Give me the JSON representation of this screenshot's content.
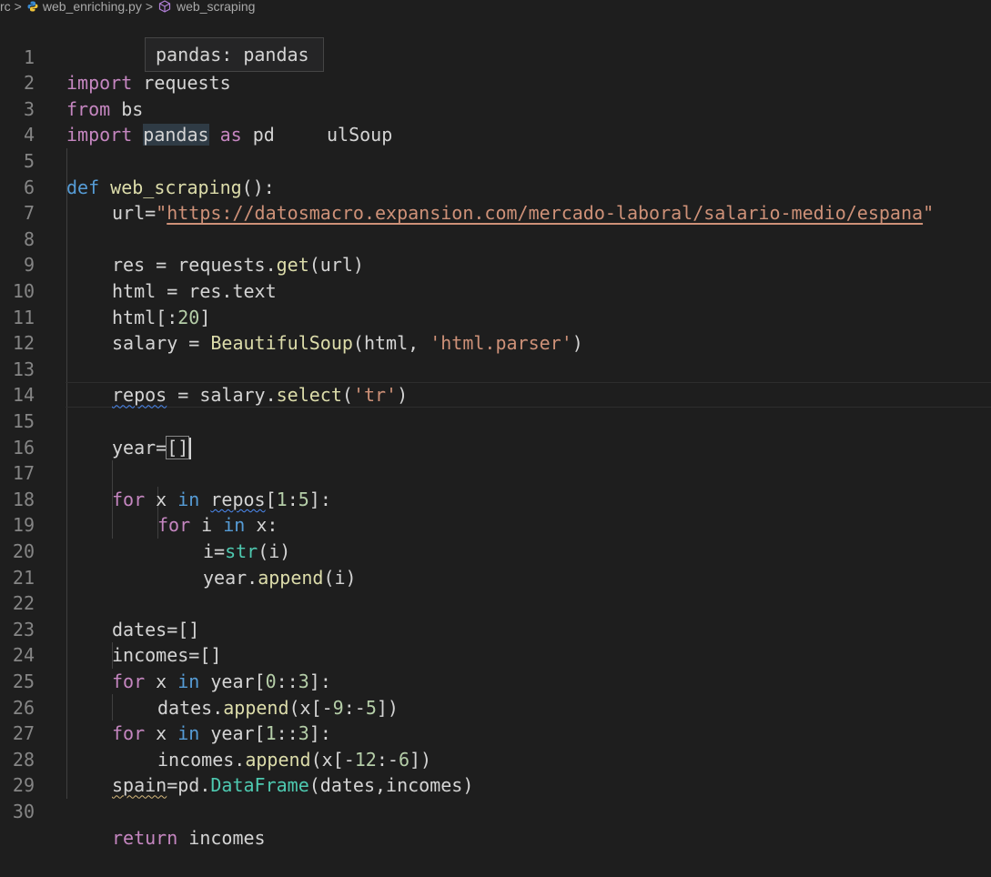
{
  "breadcrumb": {
    "segments": [
      "rc",
      "web_enriching.py",
      "web_scraping"
    ],
    "separator": ">"
  },
  "hover": {
    "text": "pandas: pandas"
  },
  "line_numbers": [
    "1",
    "2",
    "3",
    "4",
    "5",
    "6",
    "7",
    "8",
    "9",
    "10",
    "11",
    "12",
    "13",
    "14",
    "15",
    "16",
    "17",
    "18",
    "19",
    "20",
    "21",
    "22",
    "23",
    "24",
    "25",
    "26",
    "27",
    "28",
    "29",
    "30"
  ],
  "code": {
    "l1": [
      "import",
      " requests"
    ],
    "l2": [
      "from",
      " bs",
      "ulSoup"
    ],
    "l3": [
      "import",
      " ",
      "pandas",
      " ",
      "as",
      " pd"
    ],
    "l5": [
      "def",
      " ",
      "web_scraping",
      "():"
    ],
    "l6": [
      "url=",
      "\"",
      "https://datosmacro.expansion.com/mercado-laboral/salario-medio/espana",
      "\""
    ],
    "l8": [
      "res = requests.",
      "get",
      "(url)"
    ],
    "l9": [
      "html = res.text"
    ],
    "l10": [
      "html[:",
      "20",
      "]"
    ],
    "l11": [
      "salary = ",
      "BeautifulSoup",
      "(html, ",
      "'html.parser'",
      ")"
    ],
    "l13": [
      "repos",
      " = salary.",
      "select",
      "(",
      "'tr'",
      ")"
    ],
    "l15": [
      "year=",
      "[]"
    ],
    "l17": [
      "for",
      " x ",
      "in",
      " ",
      "repos",
      "[",
      "1",
      ":",
      "5",
      "]:"
    ],
    "l18": [
      "for",
      " i ",
      "in",
      " x:"
    ],
    "l19": [
      "i=",
      "str",
      "(i)"
    ],
    "l20": [
      "year.",
      "append",
      "(i)"
    ],
    "l22": [
      "dates=[]"
    ],
    "l23": [
      "incomes=[]"
    ],
    "l24": [
      "for",
      " x ",
      "in",
      " year[",
      "0",
      "::",
      "3",
      "]:"
    ],
    "l25": [
      "dates.",
      "append",
      "(x[-",
      "9",
      ":-",
      "5",
      "])"
    ],
    "l26": [
      "for",
      " x ",
      "in",
      " year[",
      "1",
      "::",
      "3",
      "]:"
    ],
    "l27": [
      "incomes.",
      "append",
      "(x[-",
      "12",
      ":-",
      "6",
      "])"
    ],
    "l28": [
      "spain",
      "=pd.",
      "DataFrame",
      "(dates,incomes)"
    ],
    "l30": [
      "return",
      " incomes"
    ]
  },
  "colors": {
    "background": "#1e1e1e",
    "keyword_control": "#c586c0",
    "keyword": "#569cd6",
    "function": "#dcdcaa",
    "builtin_type": "#4ec9b0",
    "string": "#ce9178",
    "number": "#b5cea8",
    "line_number": "#858585"
  },
  "icons": {
    "file": "python-file-icon",
    "symbol": "function-cube-icon"
  }
}
